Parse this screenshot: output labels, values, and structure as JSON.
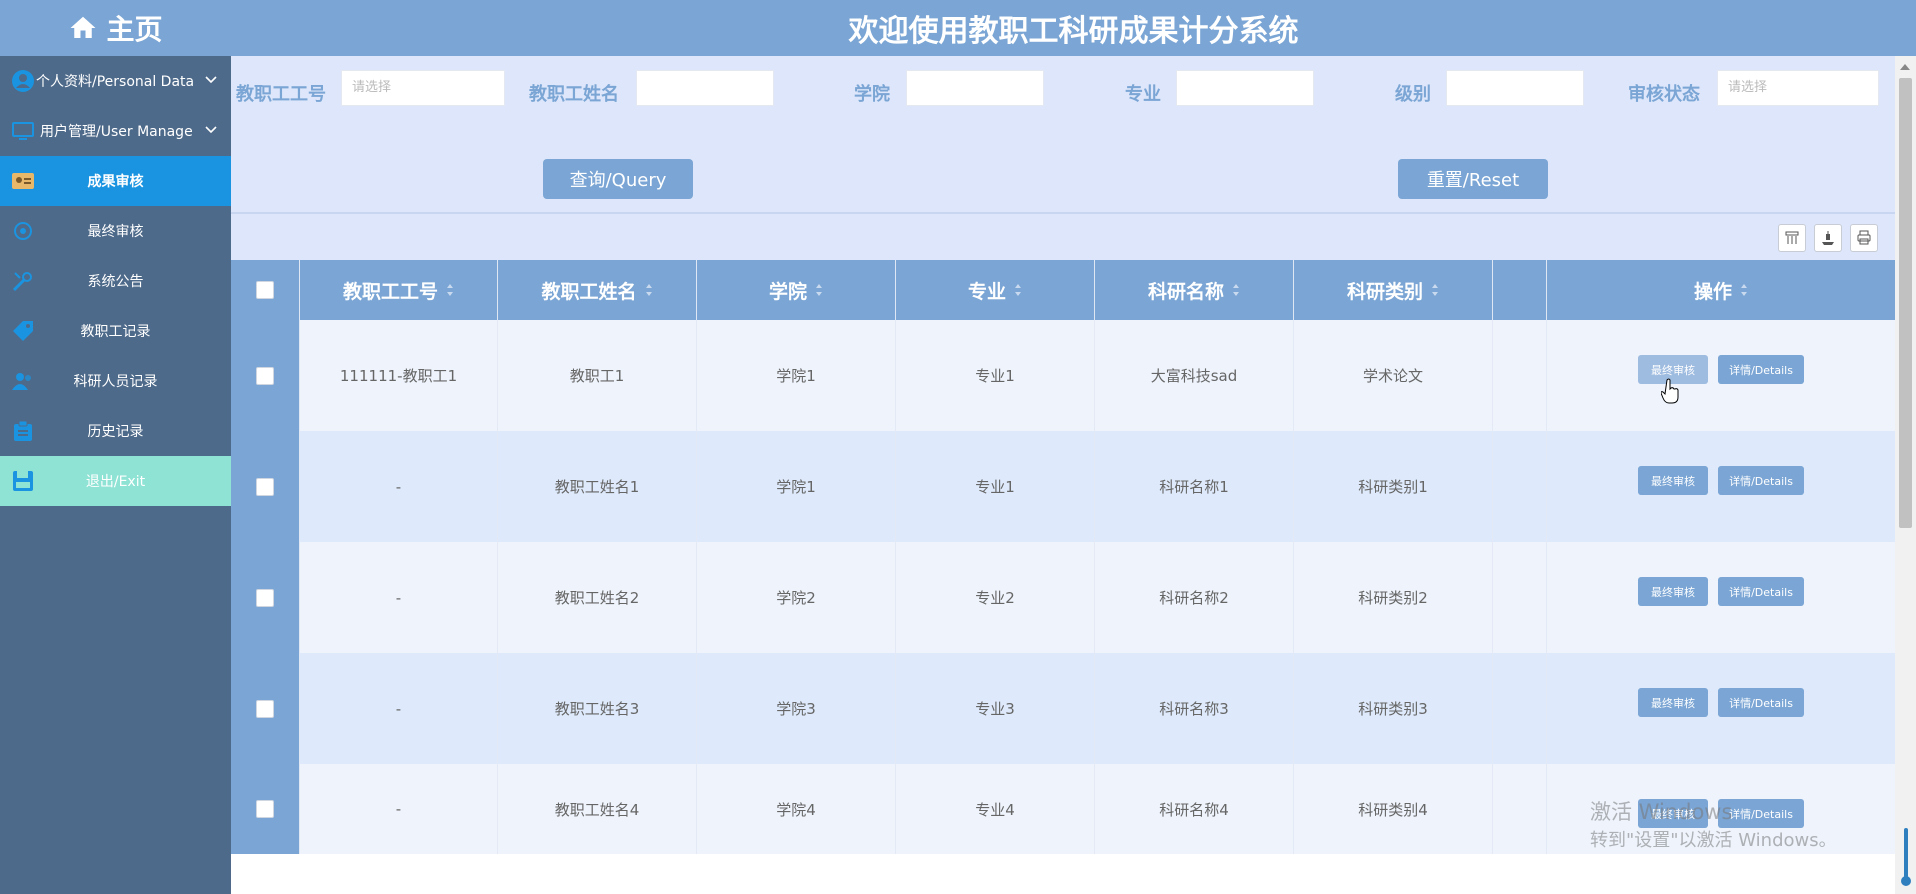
{
  "sidebar": {
    "home": "主页",
    "items": [
      {
        "label": "个人资料/Personal Data",
        "icon": "avatar-icon",
        "type": "menu"
      },
      {
        "label": "用户管理/User Manage",
        "icon": "monitor-icon",
        "type": "menu"
      },
      {
        "label": "成果审核",
        "icon": "id-card-icon",
        "type": "active"
      },
      {
        "label": "最终审核",
        "icon": "settings-icon",
        "type": "normal"
      },
      {
        "label": "系统公告",
        "icon": "tools-icon",
        "type": "normal"
      },
      {
        "label": "教职工记录",
        "icon": "tag-icon",
        "type": "normal"
      },
      {
        "label": "科研人员记录",
        "icon": "users-icon",
        "type": "normal"
      },
      {
        "label": "历史记录",
        "icon": "clipboard-icon",
        "type": "normal"
      },
      {
        "label": "退出/Exit",
        "icon": "save-icon",
        "type": "exit"
      }
    ]
  },
  "header": {
    "title": "欢迎使用教职工科研成果计分系统"
  },
  "filters": [
    {
      "label": "教职工工号",
      "placeholder": "请选择"
    },
    {
      "label": "教职工姓名",
      "placeholder": ""
    },
    {
      "label": "学院",
      "placeholder": ""
    },
    {
      "label": "专业",
      "placeholder": ""
    },
    {
      "label": "级别",
      "placeholder": ""
    },
    {
      "label": "审核状态",
      "placeholder": "请选择"
    }
  ],
  "buttons": {
    "query": "查询/Query",
    "reset": "重置/Reset"
  },
  "table": {
    "headers": [
      "教职工工号",
      "教职工姓名",
      "学院",
      "专业",
      "科研名称",
      "科研类别",
      "",
      "操作"
    ],
    "rows": [
      [
        "111111-教职工1",
        "教职工1",
        "学院1",
        "专业1",
        "大富科技sad",
        "学术论文"
      ],
      [
        "-",
        "教职工姓名1",
        "学院1",
        "专业1",
        "科研名称1",
        "科研类别1"
      ],
      [
        "-",
        "教职工姓名2",
        "学院2",
        "专业2",
        "科研名称2",
        "科研类别2"
      ],
      [
        "-",
        "教职工姓名3",
        "学院3",
        "专业3",
        "科研名称3",
        "科研类别3"
      ],
      [
        "-",
        "教职工姓名4",
        "学院4",
        "专业4",
        "科研名称4",
        "科研类别4"
      ]
    ],
    "action_final": "最终审核",
    "action_details": "详情/Details"
  },
  "watermark": {
    "line1": "激活 Windows",
    "line2": "转到\"设置\"以激活 Windows。"
  },
  "colors": {
    "primary": "#7aa5d4",
    "sidebar": "#4e6a8a",
    "active": "#1a94e0",
    "exit": "#8fe3d4",
    "content_bg": "#dde6fa"
  }
}
